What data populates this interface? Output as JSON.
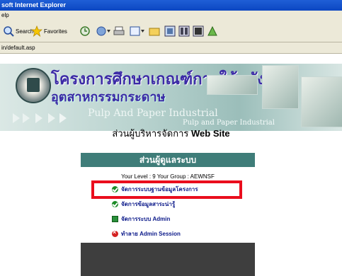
{
  "window": {
    "title": "soft Internet Explorer",
    "menu": "elp",
    "address": "in/default.asp"
  },
  "toolbar": {
    "search_label": "Search",
    "favorites_label": "Favorites"
  },
  "banner": {
    "thai_title": "โครงการศึกษาเกณฑ์การใช้พลังงาน",
    "thai_sub": "อุตสาหกรรมกระดาษ",
    "en_title": "Pulp And Paper Industrial",
    "en_sub": "Pulp and Paper Industrial"
  },
  "heading": {
    "prefix": "ส่วนผู้บริหารจัดการ",
    "suffix": "Web Site"
  },
  "panel": {
    "title": "ส่วนผู้ดูแลระบบ",
    "level_text": "Your Level : 9   Your Group : AEWNSF",
    "items": [
      {
        "label": "จัดการระบบฐานข้อมูลโครงการ",
        "icon": "check-icon"
      },
      {
        "label": "จัดการข้อมูลสาระน่ารู้",
        "icon": "check-icon"
      },
      {
        "label": "จัดการระบบ Admin",
        "icon": "admin-icon"
      },
      {
        "label": "ทำลาย Admin Session",
        "icon": "close-icon"
      }
    ]
  },
  "colors": {
    "panel_header": "#3f7d79",
    "highlight": "#ea0d1d",
    "link": "#0c1a8a"
  }
}
